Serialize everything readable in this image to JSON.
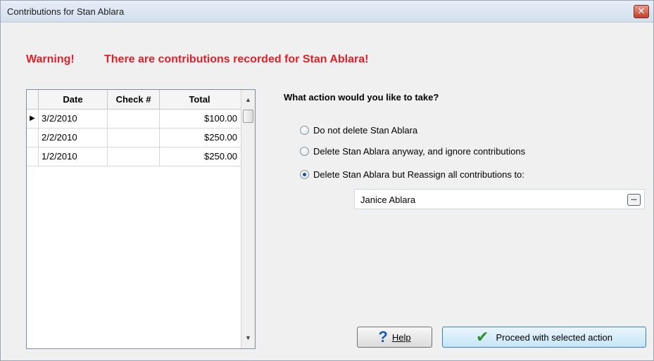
{
  "window": {
    "title": "Contributions for Stan Ablara",
    "close_symbol": "✕"
  },
  "warning": {
    "label": "Warning!",
    "message": "There are contributions recorded for Stan Ablara!"
  },
  "grid": {
    "columns": [
      "Date",
      "Check #",
      "Total"
    ],
    "rows": [
      {
        "date": "3/2/2010",
        "check": "",
        "total": "$100.00",
        "current": true
      },
      {
        "date": "2/2/2010",
        "check": "",
        "total": "$250.00",
        "current": false
      },
      {
        "date": "1/2/2010",
        "check": "",
        "total": "$250.00",
        "current": false
      }
    ]
  },
  "actions": {
    "question": "What action would you like to take?",
    "options": [
      {
        "label": "Do not delete Stan Ablara",
        "selected": false
      },
      {
        "label": "Delete Stan Ablara anyway, and ignore contributions",
        "selected": false
      },
      {
        "label": "Delete Stan Ablara but Reassign all contributions to:",
        "selected": true
      }
    ],
    "reassign_to": "Janice Ablara",
    "browse_button": "..."
  },
  "buttons": {
    "help_label": "Help",
    "proceed_label": "Proceed with selected action"
  },
  "colors": {
    "warning": "#e2202a",
    "help_icon": "#1b59b8",
    "check_icon": "#2f8f2f"
  }
}
